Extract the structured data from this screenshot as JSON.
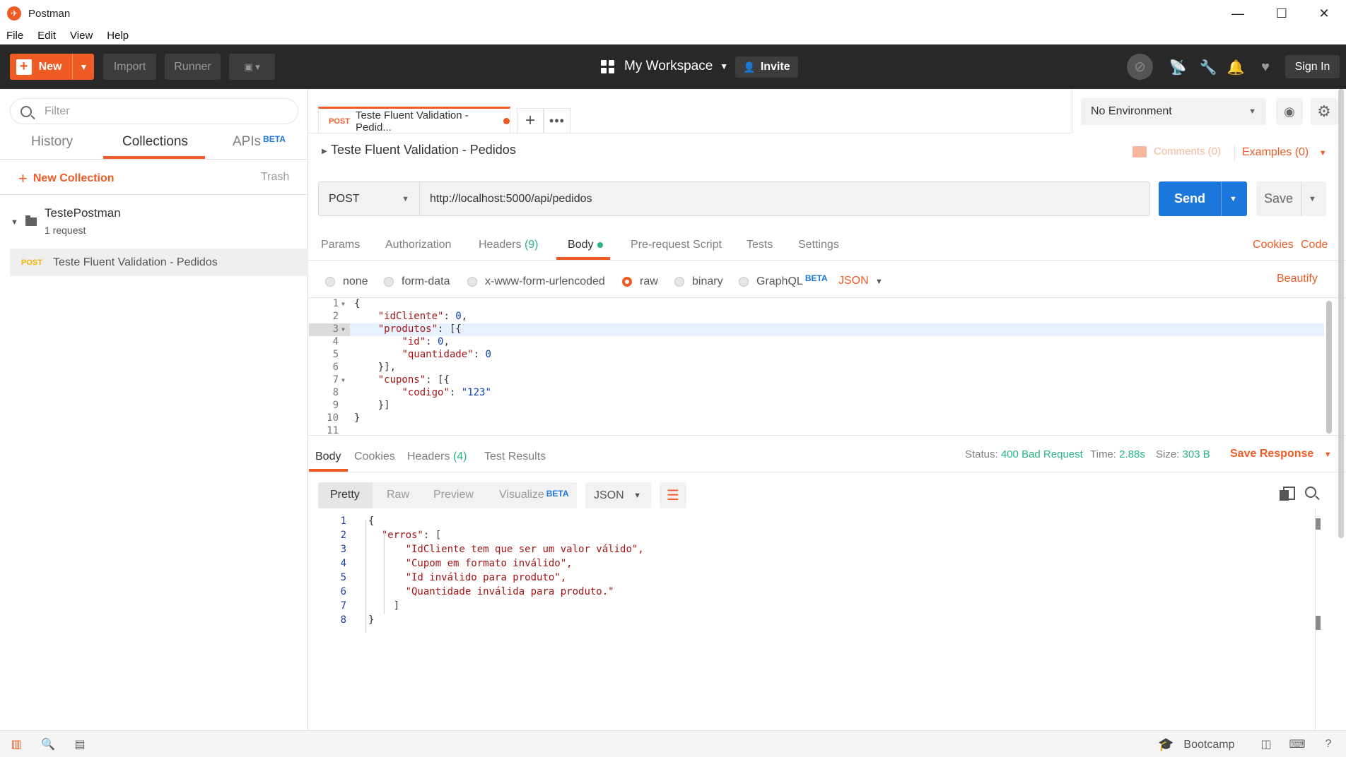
{
  "window": {
    "title": "Postman",
    "minimize": "—",
    "maximize": "☐",
    "close": "✕"
  },
  "menu": [
    "File",
    "Edit",
    "View",
    "Help"
  ],
  "header": {
    "new_label": "New",
    "import_label": "Import",
    "runner_label": "Runner",
    "workspace_label": "My Workspace",
    "invite_label": "Invite",
    "signin_label": "Sign In"
  },
  "sidebar": {
    "filter_placeholder": "Filter",
    "tabs": {
      "history": "History",
      "collections": "Collections",
      "apis": "APIs",
      "beta": "BETA"
    },
    "new_collection": "New Collection",
    "trash": "Trash",
    "collection": {
      "name": "TestePostman",
      "count": "1 request"
    },
    "request": {
      "method": "POST",
      "name": "Teste Fluent Validation - Pedidos"
    }
  },
  "tab": {
    "method": "POST",
    "title": "Teste Fluent Validation - Pedid..."
  },
  "environment": {
    "selected": "No Environment"
  },
  "request": {
    "name": "Teste Fluent Validation - Pedidos",
    "comments": "Comments (0)",
    "examples": "Examples (0)",
    "method": "POST",
    "url": "http://localhost:5000/api/pedidos",
    "send_label": "Send",
    "save_label": "Save",
    "subtabs": {
      "params": "Params",
      "authorization": "Authorization",
      "headers": "Headers",
      "headers_count": "(9)",
      "body": "Body",
      "prerequest": "Pre-request Script",
      "tests": "Tests",
      "settings": "Settings"
    },
    "cookies": "Cookies",
    "code": "Code",
    "body_types": {
      "none": "none",
      "form_data": "form-data",
      "urlencoded": "x-www-form-urlencoded",
      "raw": "raw",
      "binary": "binary",
      "graphql": "GraphQL",
      "beta": "BETA"
    },
    "body_format": "JSON",
    "beautify": "Beautify",
    "body_lines": {
      "l1": "{",
      "l2k": "\"idCliente\"",
      "l2v": "0",
      "l3k": "\"produtos\"",
      "l3v": "[{",
      "l4k": "\"id\"",
      "l4v": "0",
      "l5k": "\"quantidade\"",
      "l5v": "0",
      "l6": "}],",
      "l7k": "\"cupons\"",
      "l7v": "[{",
      "l8k": "\"codigo\"",
      "l8v": "\"123\"",
      "l9": "}]",
      "l10": "}"
    }
  },
  "response": {
    "tabs": {
      "body": "Body",
      "cookies": "Cookies",
      "headers": "Headers",
      "headers_count": "(4)",
      "test_results": "Test Results"
    },
    "status_label": "Status:",
    "status_value": "400 Bad Request",
    "time_label": "Time:",
    "time_value": "2.88s",
    "size_label": "Size:",
    "size_value": "303 B",
    "save_response": "Save Response",
    "views": {
      "pretty": "Pretty",
      "raw": "Raw",
      "preview": "Preview",
      "visualize": "Visualize",
      "beta": "BETA"
    },
    "format": "JSON",
    "lines": {
      "l1": "{",
      "l2k": "\"erros\"",
      "l2v": "[",
      "l3": "\"IdCliente tem que ser um valor válido\",",
      "l4": "\"Cupom em formato inválido\",",
      "l5": "\"Id inválido para produto\",",
      "l6": "\"Quantidade inválida para produto.\"",
      "l7": "]",
      "l8": "}"
    }
  },
  "statusbar": {
    "bootcamp": "Bootcamp"
  }
}
